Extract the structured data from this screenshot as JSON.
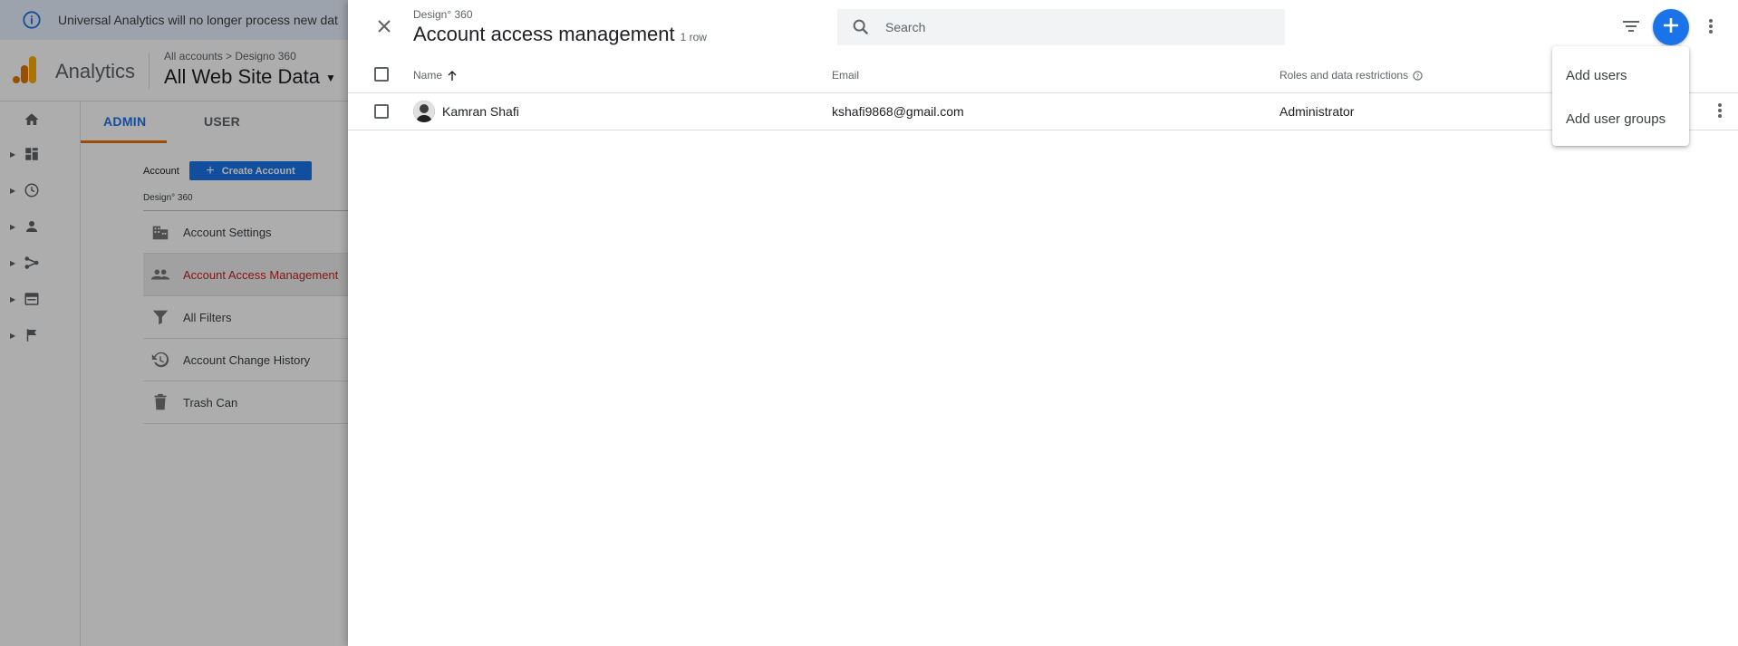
{
  "banner": {
    "text": "Universal Analytics will no longer process new dat"
  },
  "app": {
    "name": "Analytics",
    "breadcrumb": "All accounts > Designo 360",
    "view": "All Web Site Data"
  },
  "tabs": [
    {
      "label": "ADMIN"
    },
    {
      "label": "USER"
    }
  ],
  "admin": {
    "account_label": "Account",
    "create_button": "Create Account",
    "account_name": "Design° 360",
    "items": [
      {
        "label": "Account Settings",
        "icon": "building-icon"
      },
      {
        "label": "Account Access Management",
        "icon": "people-icon"
      },
      {
        "label": "All Filters",
        "icon": "filter-icon"
      },
      {
        "label": "Account Change History",
        "icon": "history-icon"
      },
      {
        "label": "Trash Can",
        "icon": "trash-icon"
      }
    ]
  },
  "panel": {
    "subtitle": "Design° 360",
    "title": "Account access management",
    "row_count": "1 row",
    "search_placeholder": "Search",
    "columns": {
      "name": "Name",
      "email": "Email",
      "roles": "Roles and data restrictions"
    },
    "rows": [
      {
        "name": "Kamran Shafi",
        "email": "kshafi9868@gmail.com",
        "role": "Administrator"
      }
    ]
  },
  "menu": {
    "items": [
      {
        "label": "Add users"
      },
      {
        "label": "Add user groups"
      }
    ]
  },
  "colors": {
    "accent": "#1a73e8",
    "brand_orange": "#e8710a",
    "active_red": "#c5221f"
  }
}
